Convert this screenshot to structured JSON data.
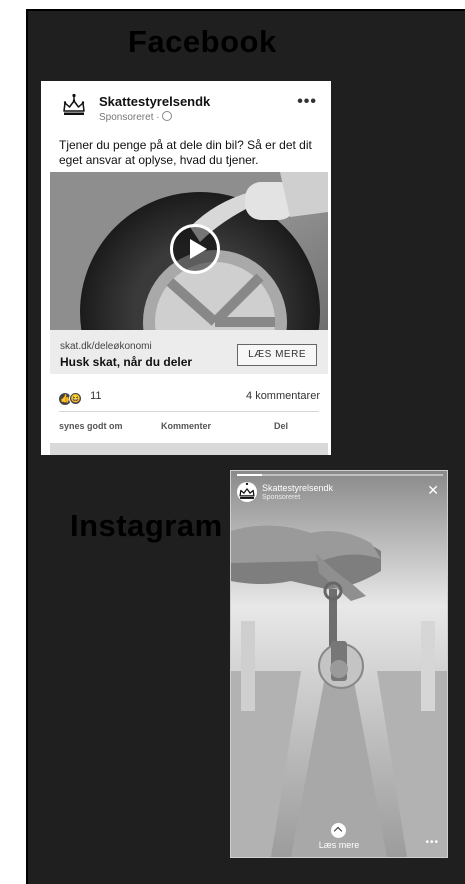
{
  "titles": {
    "facebook": "Facebook",
    "instagram": "Instagram"
  },
  "facebook_ad": {
    "page_name": "Skattestyrelsendk",
    "sponsored": "Sponsoreret ·",
    "menu_icon": "more-dots-icon",
    "body_text": "Tjener du penge på at dele din bil? Så er det dit eget ansvar at oplyse, hvad du tjener.",
    "video_icon": "play-icon",
    "link_url": "skat.dk/deleøkonomi",
    "link_headline": "Husk skat, når du deler",
    "cta_label": "LÆS MERE",
    "reaction_count": "11",
    "comment_count": "4 kommentarer",
    "actions": {
      "like": "synes godt om",
      "comment": "Kommenter",
      "share": "Del"
    }
  },
  "instagram_story": {
    "account": "Skattestyrelsendk",
    "sponsored": "Sponsoreret",
    "close_icon": "close-icon",
    "cta_label": "Læs mere",
    "progress": 0.12
  },
  "colors": {
    "board": "#1f1f1f",
    "card": "#ffffff",
    "link_bar": "#ececec"
  }
}
